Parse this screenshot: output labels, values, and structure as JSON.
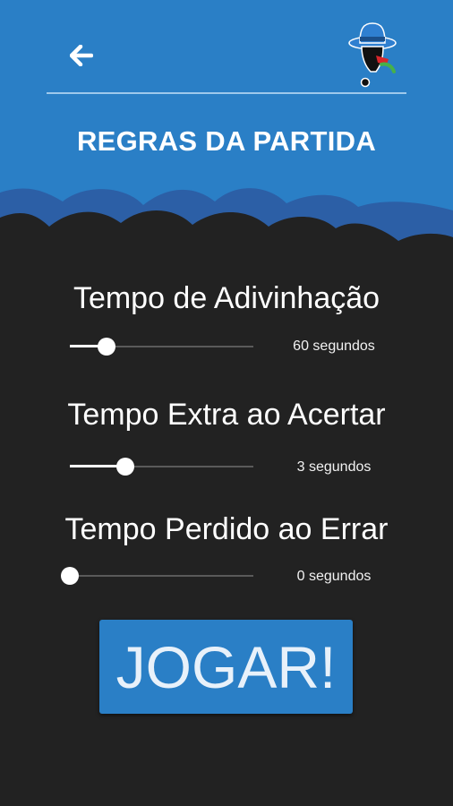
{
  "theme": {
    "accent": "#2a7fc6",
    "background": "#222222",
    "clouds": "#2c5fa6"
  },
  "header": {
    "back_icon": "arrow-left-icon",
    "mascot_icon": "detective-mascot-icon",
    "title": "REGRAS DA PARTIDA"
  },
  "settings": [
    {
      "label": "Tempo de Adivinhação",
      "value_text": "60 segundos",
      "level": 0.2
    },
    {
      "label": "Tempo Extra ao Acertar",
      "value_text": "3 segundos",
      "level": 0.3
    },
    {
      "label": "Tempo Perdido ao Errar",
      "value_text": "0 segundos",
      "level": 0.0
    }
  ],
  "play_button": {
    "label": "JOGAR!"
  }
}
